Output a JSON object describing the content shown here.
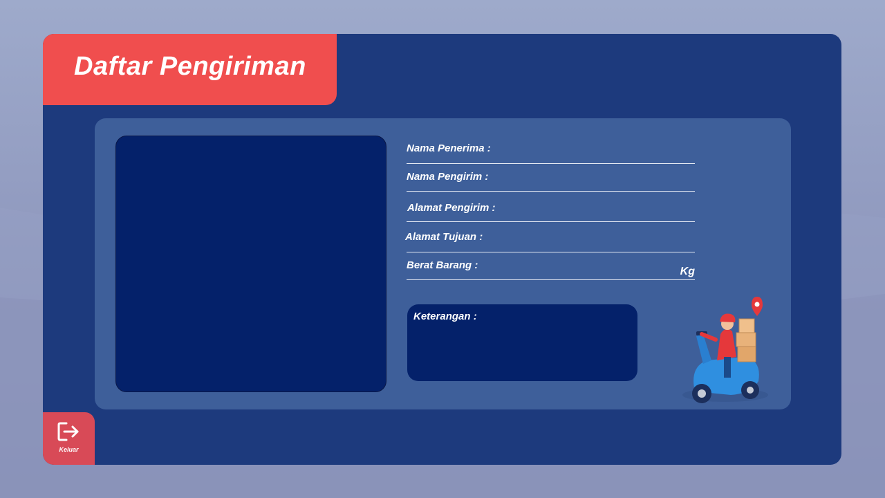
{
  "window": {
    "title": "Daftar Pengiriman"
  },
  "form": {
    "fields": [
      {
        "label": "Nama Penerima :"
      },
      {
        "label": "Nama Pengirim :"
      },
      {
        "label": "Alamat Pengirim :"
      },
      {
        "label": "Alamat Tujuan :"
      },
      {
        "label": "Berat Barang :",
        "unit": "Kg"
      }
    ],
    "notes_label": "Keterangan :"
  },
  "logout": {
    "label": "Keluar",
    "icon": "logout-icon"
  },
  "colors": {
    "window_bg": "#1d3a7d",
    "card_bg": "#3e5f9a",
    "panel_dark": "#04216a",
    "accent_red": "#f04e4e",
    "logout_red": "#d84a57"
  }
}
